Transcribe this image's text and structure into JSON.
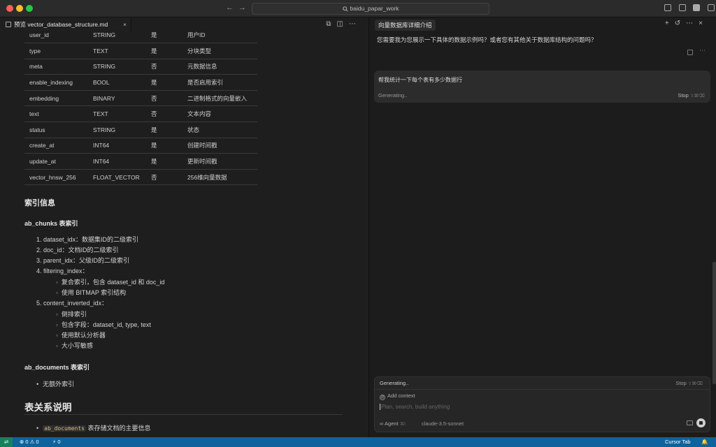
{
  "titlebar": {
    "back_arrow": "←",
    "forward_arrow": "→",
    "search_text": "baidu_papar_work"
  },
  "editor": {
    "tab_label": "预览 vector_database_structure.md",
    "tab_close": "×",
    "fields_table": [
      [
        "user_id",
        "STRING",
        "是",
        "用户ID"
      ],
      [
        "type",
        "TEXT",
        "是",
        "分块类型"
      ],
      [
        "meta",
        "STRING",
        "否",
        "元数据信息"
      ],
      [
        "enable_indexing",
        "BOOL",
        "是",
        "是否启用索引"
      ],
      [
        "embedding",
        "BINARY",
        "否",
        "二进制格式的向量嵌入"
      ],
      [
        "text",
        "TEXT",
        "否",
        "文本内容"
      ],
      [
        "status",
        "STRING",
        "是",
        "状态"
      ],
      [
        "create_at",
        "INT64",
        "是",
        "创建时间戳"
      ],
      [
        "update_at",
        "INT64",
        "是",
        "更新时间戳"
      ],
      [
        "vector_hnsw_256",
        "FLOAT_VECTOR",
        "否",
        "256维向量数据"
      ]
    ],
    "index_heading": "索引信息",
    "chunks_heading": "ab_chunks 表索引",
    "chunk_indexes": [
      "1. dataset_idx：数据集ID的二级索引",
      "2. doc_id：文档ID的二级索引",
      "3. parent_idx：父级ID的二级索引",
      "4. filtering_index："
    ],
    "filtering_subs": [
      "复合索引，包含 dataset_id 和 doc_id",
      "使用 BITMAP 索引结构"
    ],
    "inverted_item": "5. content_inverted_idx：",
    "inverted_subs": [
      "倒排索引",
      "包含字段：dataset_id, type, text",
      "使用默认分析器",
      "大小写敏感"
    ],
    "documents_heading": "ab_documents 表索引",
    "documents_bullets": [
      "无额外索引"
    ],
    "relations_heading": "表关系说明",
    "relations_code": "ab_documents",
    "relations_text": " 表存储文档的主要信息"
  },
  "chat": {
    "title": "向量数据库详细介绍",
    "assistant_message": "您需要我为您展示一下具体的数据示例吗？或者您有其他关于数据库结构的问题吗？",
    "user_message": "帮我统计一下每个表有多少数据行",
    "generating_label": "Generating..",
    "stop_label": "Stop",
    "stop_shortcut": "⇧⌘⌫",
    "composer": {
      "generating_label": "Generating..",
      "stop_label": "Stop",
      "stop_shortcut": "⇧⌘⌫",
      "add_context": "Add context",
      "input_placeholder": "Plan, search, build anything",
      "agent_label": "Agent",
      "agent_shortcut": "⌘I",
      "model_label": "claude-3.5-sonnet"
    }
  },
  "statusbar": {
    "remote_icon": "⇌",
    "problems": "⊗ 0 ⚠ 0",
    "ports": "⚡ 0",
    "cursor_tab": "Cursor Tab",
    "bell": "🔔"
  }
}
